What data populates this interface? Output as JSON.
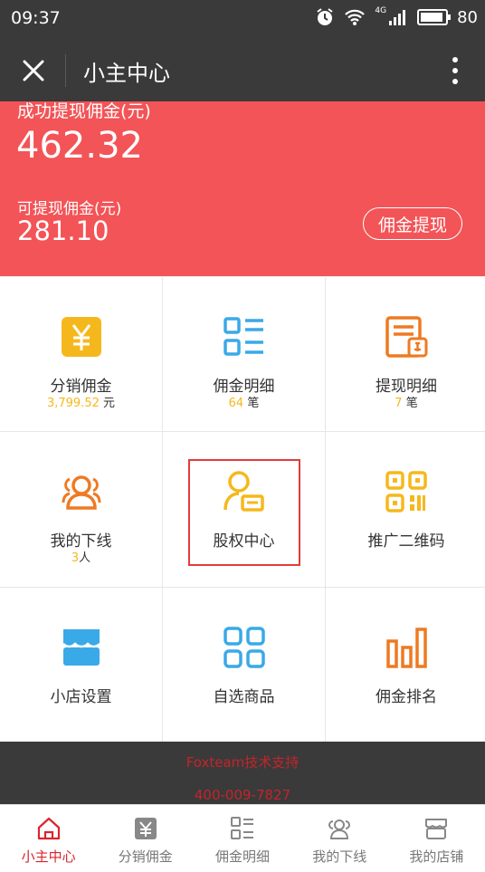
{
  "status": {
    "time": "09:37",
    "network": "4G",
    "battery": "80"
  },
  "header": {
    "title": "小主中心"
  },
  "banner": {
    "withdrawn_label": "成功提现佣金(元)",
    "withdrawn_value": "462.32",
    "available_label": "可提现佣金(元)",
    "available_value": "281.10",
    "withdraw_button": "佣金提现"
  },
  "grid": [
    {
      "name": "分销佣金",
      "num": "3,799.52",
      "unit": " 元",
      "icon": "yen-icon",
      "color": "#f5b81c"
    },
    {
      "name": "佣金明细",
      "num": "64",
      "unit": " 笔",
      "icon": "list-icon",
      "color": "#3aa9e8"
    },
    {
      "name": "提现明细",
      "num": "7",
      "unit": " 笔",
      "icon": "withdraw-record-icon",
      "color": "#ee7a22"
    },
    {
      "name": "我的下线",
      "num": "3",
      "unit": "人",
      "icon": "users-icon",
      "color": "#ee7a22"
    },
    {
      "name": "股权中心",
      "icon": "equity-user-icon",
      "color": "#f5b81c"
    },
    {
      "name": "推广二维码",
      "icon": "qrcode-icon",
      "color": "#f5b81c"
    },
    {
      "name": "小店设置",
      "icon": "shop-icon",
      "color": "#3aa9e8"
    },
    {
      "name": "自选商品",
      "icon": "grid-icon",
      "color": "#3aa9e8"
    },
    {
      "name": "佣金排名",
      "icon": "bar-chart-icon",
      "color": "#ee7a22"
    }
  ],
  "footer": {
    "line1": "Foxteam技术支持",
    "line2": "400-009-7827"
  },
  "tabs": [
    {
      "label": "小主中心",
      "icon": "home-icon"
    },
    {
      "label": "分销佣金",
      "icon": "yen-icon"
    },
    {
      "label": "佣金明细",
      "icon": "list-icon"
    },
    {
      "label": "我的下线",
      "icon": "users-icon"
    },
    {
      "label": "我的店铺",
      "icon": "store-icon"
    }
  ],
  "colors": {
    "header": "#3a3a3a",
    "banner": "#f35457",
    "accent": "#d9262c",
    "yellow": "#f5b81c",
    "blue": "#3aa9e8",
    "orange": "#ee7a22"
  }
}
